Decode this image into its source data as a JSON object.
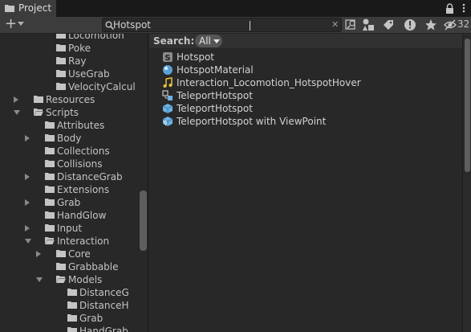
{
  "window": {
    "tab_title": "Project",
    "icons": {
      "tab": "folder-icon",
      "lock": "lock-icon",
      "menu": "kebab-menu-icon"
    }
  },
  "toolbar": {
    "add_icon": "plus-icon",
    "search_value": "Hotspot",
    "clear_icon": "close-icon",
    "hidden_count": "32"
  },
  "tree": {
    "items": [
      {
        "label": "Locomotion",
        "icon": "folder-icon"
      },
      {
        "label": "Poke",
        "icon": "folder-icon"
      },
      {
        "label": "Ray",
        "icon": "folder-icon"
      },
      {
        "label": "UseGrab",
        "icon": "folder-icon"
      },
      {
        "label": "VelocityCalcul",
        "icon": "folder-icon"
      },
      {
        "label": "Resources",
        "icon": "folder-icon"
      },
      {
        "label": "Scripts",
        "icon": "folder-open-icon"
      },
      {
        "label": "Attributes",
        "icon": "folder-icon"
      },
      {
        "label": "Body",
        "icon": "folder-icon"
      },
      {
        "label": "Collections",
        "icon": "folder-icon"
      },
      {
        "label": "Collisions",
        "icon": "folder-icon"
      },
      {
        "label": "DistanceGrab",
        "icon": "folder-icon"
      },
      {
        "label": "Extensions",
        "icon": "folder-icon"
      },
      {
        "label": "Grab",
        "icon": "folder-icon"
      },
      {
        "label": "HandGlow",
        "icon": "folder-icon"
      },
      {
        "label": "Input",
        "icon": "folder-icon"
      },
      {
        "label": "Interaction",
        "icon": "folder-open-icon"
      },
      {
        "label": "Core",
        "icon": "folder-icon"
      },
      {
        "label": "Grabbable",
        "icon": "folder-icon"
      },
      {
        "label": "Models",
        "icon": "folder-open-icon"
      },
      {
        "label": "DistanceG",
        "icon": "folder-icon"
      },
      {
        "label": "DistanceH",
        "icon": "folder-icon"
      },
      {
        "label": "Grab",
        "icon": "folder-icon"
      },
      {
        "label": "HandGrab",
        "icon": "folder-icon"
      }
    ]
  },
  "results": {
    "search_label": "Search:",
    "scope": "All",
    "items": [
      {
        "label": "Hotspot",
        "icon": "script-icon"
      },
      {
        "label": "HotspotMaterial",
        "icon": "material-icon"
      },
      {
        "label": "Interaction_Locomotion_HotspotHover",
        "icon": "audio-clip-icon"
      },
      {
        "label": "TeleportHotspot",
        "icon": "prefab-variant-icon"
      },
      {
        "label": "TeleportHotspot",
        "icon": "prefab-icon"
      },
      {
        "label": "TeleportHotspot with ViewPoint",
        "icon": "prefab-striped-icon"
      }
    ]
  }
}
